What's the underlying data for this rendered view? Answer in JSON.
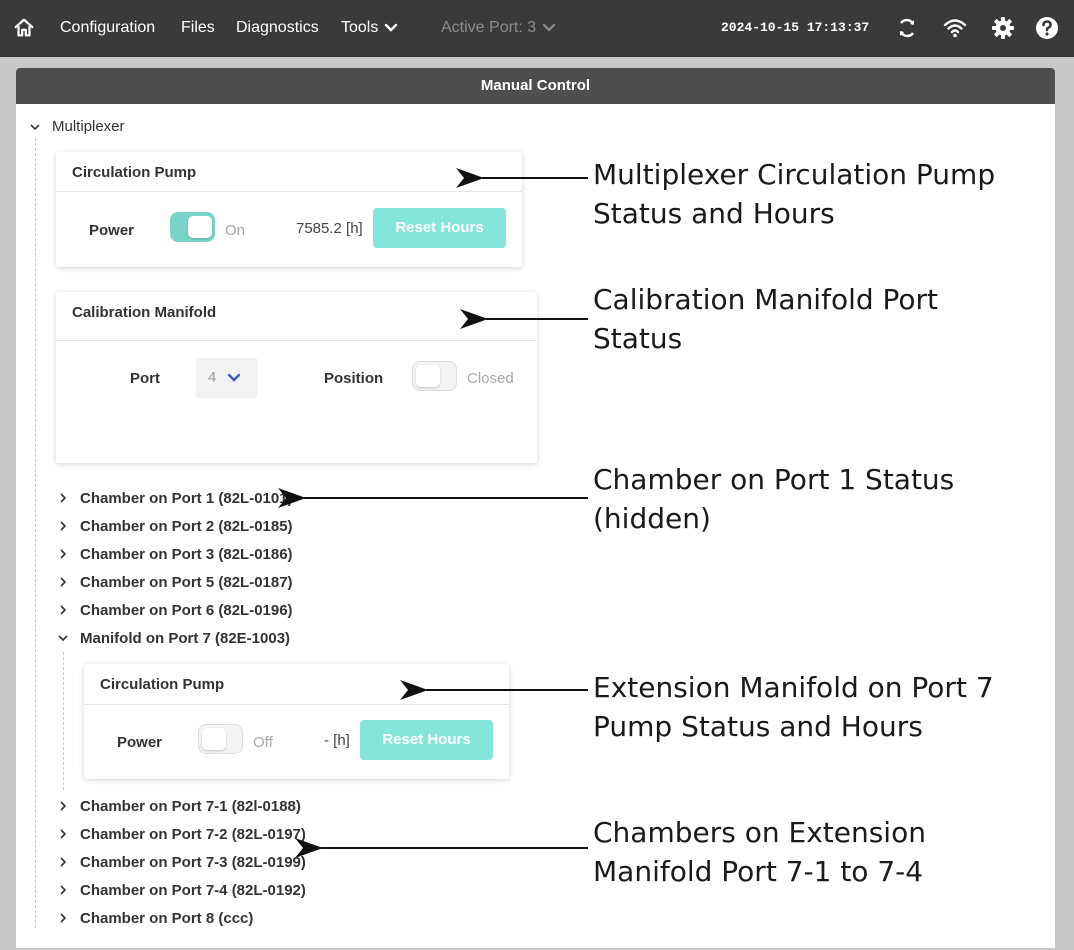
{
  "topbar": {
    "nav": [
      "Configuration",
      "Files",
      "Diagnostics",
      "Tools"
    ],
    "active_port": "Active Port: 3",
    "datetime": "2024-10-15 17:13:37",
    "icons": [
      "home-icon",
      "chevron-down-icon",
      "sync-icon",
      "wifi-icon",
      "gear-icon",
      "help-icon"
    ]
  },
  "panel": {
    "title": "Manual Control",
    "root": "Multiplexer",
    "circulation_pump": {
      "title": "Circulation Pump",
      "power_label": "Power",
      "state": "On",
      "hours": "7585.2 [h]",
      "reset": "Reset Hours"
    },
    "calibration_manifold": {
      "title": "Calibration Manifold",
      "port_label": "Port",
      "port_value": "4",
      "position_label": "Position",
      "position_state": "Closed"
    },
    "chambers_top": [
      "Chamber on Port 1 (82L-0101)",
      "Chamber on Port 2 (82L-0185)",
      "Chamber on Port 3 (82L-0186)",
      "Chamber on Port 5 (82L-0187)",
      "Chamber on Port 6 (82L-0196)"
    ],
    "manifold": "Manifold on Port 7 (82E-1003)",
    "ext_pump": {
      "title": "Circulation Pump",
      "power_label": "Power",
      "state": "Off",
      "hours": "- [h]",
      "reset": "Reset Hours"
    },
    "chambers_bottom": [
      "Chamber on Port 7-1 (82l-0188)",
      "Chamber on Port 7-2 (82L-0197)",
      "Chamber on Port 7-3 (82L-0199)",
      "Chamber on Port 7-4 (82L-0192)",
      "Chamber on Port 8 (ccc)"
    ]
  },
  "annotations": {
    "pump": [
      "Multiplexer Circulation Pump",
      "Status and Hours"
    ],
    "calibration": [
      "Calibration Manifold Port",
      "Status"
    ],
    "chamber1": [
      "Chamber on Port 1 Status",
      "(hidden)"
    ],
    "extension": [
      "Extension Manifold on Port 7",
      "Pump Status and Hours"
    ],
    "chambers_ext": [
      "Chambers on Extension",
      "Manifold Port 7-1 to 7-4"
    ]
  },
  "colors": {
    "topbar": "#3a3a3a",
    "panel_header": "#4e4e4e",
    "toggle_on": "#79d4c8",
    "reset_button": "#84e6d9",
    "select_arrow": "#3b5bc7"
  }
}
